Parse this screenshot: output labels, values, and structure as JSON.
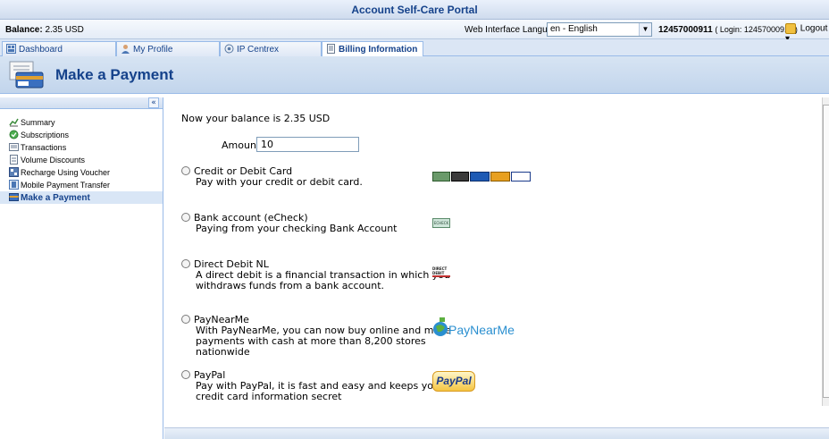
{
  "header": {
    "title": "Account Self-Care Portal",
    "balance_label": "Balance:",
    "balance_value": "2.35 USD",
    "language_label": "Web Interface Language:",
    "language_value": "en - English",
    "account_number": "12457000911",
    "account_login": "( Login: 12457000911 )",
    "logout_label": "Logout"
  },
  "tabs": [
    {
      "label": "Dashboard",
      "icon": "dashboard-icon"
    },
    {
      "label": "My Profile",
      "icon": "profile-icon"
    },
    {
      "label": "IP Centrex",
      "icon": "ip-centrex-icon"
    },
    {
      "label": "Billing Information",
      "icon": "billing-icon",
      "active": true
    }
  ],
  "page": {
    "title": "Make a Payment",
    "icon": "payment-card-icon"
  },
  "sidebar": {
    "collapse_glyph": "«",
    "items": [
      {
        "label": "Summary",
        "icon": "summary-icon"
      },
      {
        "label": "Subscriptions",
        "icon": "subscriptions-icon"
      },
      {
        "label": "Transactions",
        "icon": "transactions-icon"
      },
      {
        "label": "Volume Discounts",
        "icon": "volume-discounts-icon"
      },
      {
        "label": "Recharge Using Voucher",
        "icon": "voucher-icon"
      },
      {
        "label": "Mobile Payment Transfer",
        "icon": "mobile-transfer-icon"
      },
      {
        "label": "Make a Payment",
        "icon": "payment-icon",
        "active": true
      }
    ]
  },
  "main": {
    "balance_text": "Now your balance is 2.35 USD",
    "amount_label": "Amount:",
    "amount_value": "10",
    "options": [
      {
        "name": "Credit or Debit Card",
        "description": "Pay with your credit or debit card.",
        "logo": "credit-cards-logo"
      },
      {
        "name": "Bank account (eCheck)",
        "description": "Paying from your checking Bank Account",
        "logo": "echeck-logo",
        "logo_text": "ECHECK"
      },
      {
        "name": "Direct Debit NL",
        "description": "A direct debit is a financial transaction in which you withdraws funds from a bank account.",
        "logo": "direct-debit-logo",
        "logo_text": "DIRECT DEBIT"
      },
      {
        "name": "PayNearMe",
        "description": "With PayNearMe, you can now buy online and make payments with cash at more than 8,200 stores nationwide",
        "logo": "paynearme-logo",
        "logo_text": "PayNearMe"
      },
      {
        "name": "PayPal",
        "description": "Pay with PayPal, it is fast and easy and keeps you credit card information secret",
        "logo": "paypal-logo",
        "logo_text": "PayPal"
      }
    ]
  },
  "colors": {
    "brand_blue": "#15428b",
    "border_blue": "#99bbe8",
    "header_bg": "#cfdcee"
  }
}
